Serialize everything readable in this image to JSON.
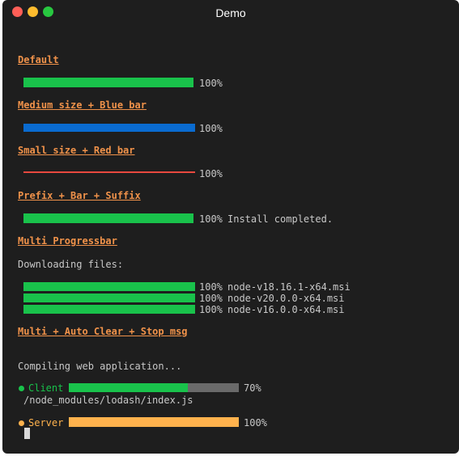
{
  "window": {
    "title": "Demo"
  },
  "colors": {
    "green": "#19c24b",
    "blue": "#0a6bd0",
    "red": "#e8493f",
    "orange": "#ffb24d",
    "gray": "#6a6a6a",
    "heading": "#f0924a"
  },
  "sections": {
    "default": {
      "heading": "Default",
      "percent": "100%",
      "progress": 1.0
    },
    "medium": {
      "heading": "Medium size + Blue bar",
      "percent": "100%",
      "progress": 1.0
    },
    "small": {
      "heading": "Small size + Red bar",
      "percent": "100%",
      "progress": 1.0
    },
    "prefix": {
      "heading": "Prefix + Bar + Suffix",
      "percent": "100%",
      "suffix": "Install completed.",
      "progress": 1.0
    },
    "multi": {
      "heading": "Multi Progressbar",
      "intro": "Downloading files:",
      "items": [
        {
          "percent": "100%",
          "file": "node-v18.16.1-x64.msi",
          "progress": 1.0
        },
        {
          "percent": "100%",
          "file": "node-v20.0.0-x64.msi",
          "progress": 1.0
        },
        {
          "percent": "100%",
          "file": "node-v16.0.0-x64.msi",
          "progress": 1.0
        }
      ]
    },
    "auto": {
      "heading": "Multi + Auto Clear + Stop msg",
      "intro": "Compiling web application...",
      "client": {
        "label": "Client",
        "percent": "70%",
        "file": "/node_modules/lodash/index.js",
        "progress": 0.7
      },
      "server": {
        "label": "Server",
        "percent": "100%",
        "progress": 1.0
      }
    }
  }
}
